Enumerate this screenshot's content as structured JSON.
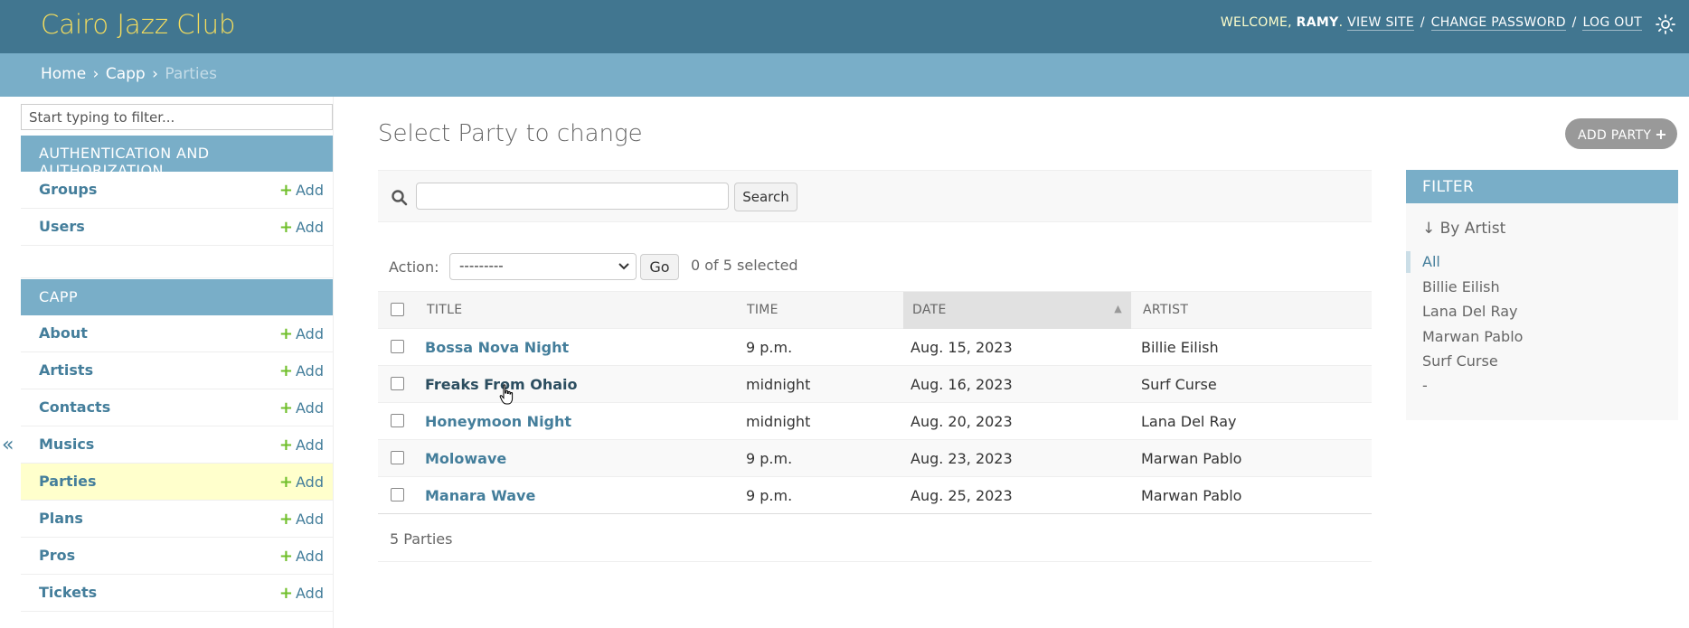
{
  "header": {
    "site_name": "Cairo Jazz Club",
    "welcome": "WELCOME,",
    "user": "RAMY",
    "period": ".",
    "view_site": "VIEW SITE",
    "change_password": "CHANGE PASSWORD",
    "log_out": "LOG OUT",
    "sep": "/"
  },
  "breadcrumbs": {
    "home": "Home",
    "app": "Capp",
    "current": "Parties",
    "arrow": "›"
  },
  "nav": {
    "filter_placeholder": "Start typing to filter...",
    "collapse": "«",
    "add_label": "Add",
    "add_plus": "+",
    "apps": [
      {
        "caption": "AUTHENTICATION AND AUTHORIZATION",
        "models": [
          {
            "name": "Groups"
          },
          {
            "name": "Users"
          }
        ]
      },
      {
        "caption": "CAPP",
        "models": [
          {
            "name": "About"
          },
          {
            "name": "Artists"
          },
          {
            "name": "Contacts"
          },
          {
            "name": "Musics"
          },
          {
            "name": "Parties"
          },
          {
            "name": "Plans"
          },
          {
            "name": "Pros"
          },
          {
            "name": "Tickets"
          }
        ]
      }
    ]
  },
  "main": {
    "title": "Select Party to change",
    "add_button": "ADD PARTY",
    "add_plus": "+",
    "search": {
      "button": "Search",
      "value": ""
    },
    "action": {
      "label": "Action:",
      "selected": "---------",
      "go": "Go",
      "counter": "0 of 5 selected"
    },
    "table": {
      "columns": [
        "TITLE",
        "TIME",
        "DATE",
        "ARTIST"
      ],
      "sorted_column": "DATE",
      "rows": [
        {
          "title": "Bossa Nova Night",
          "time": "9 p.m.",
          "date": "Aug. 15, 2023",
          "artist": "Billie Eilish"
        },
        {
          "title": "Freaks From Ohaio",
          "time": "midnight",
          "date": "Aug. 16, 2023",
          "artist": "Surf Curse"
        },
        {
          "title": "Honeymoon Night",
          "time": "midnight",
          "date": "Aug. 20, 2023",
          "artist": "Lana Del Ray"
        },
        {
          "title": "Molowave",
          "time": "9 p.m.",
          "date": "Aug. 23, 2023",
          "artist": "Marwan Pablo"
        },
        {
          "title": "Manara Wave",
          "time": "9 p.m.",
          "date": "Aug. 25, 2023",
          "artist": "Marwan Pablo"
        }
      ]
    },
    "paginator": "5 Parties"
  },
  "filter": {
    "title": "FILTER",
    "by": "↓ By Artist",
    "options": [
      "All",
      "Billie Eilish",
      "Lana Del Ray",
      "Marwan Pablo",
      "Surf Curse",
      "-"
    ],
    "selected": "All"
  },
  "colors": {
    "header_bg": "#417690",
    "brand": "#f5dd5d",
    "accent": "#79aec8",
    "link": "#447e9b",
    "add_green": "#70bf2b",
    "current_row": "#ffffcc"
  }
}
